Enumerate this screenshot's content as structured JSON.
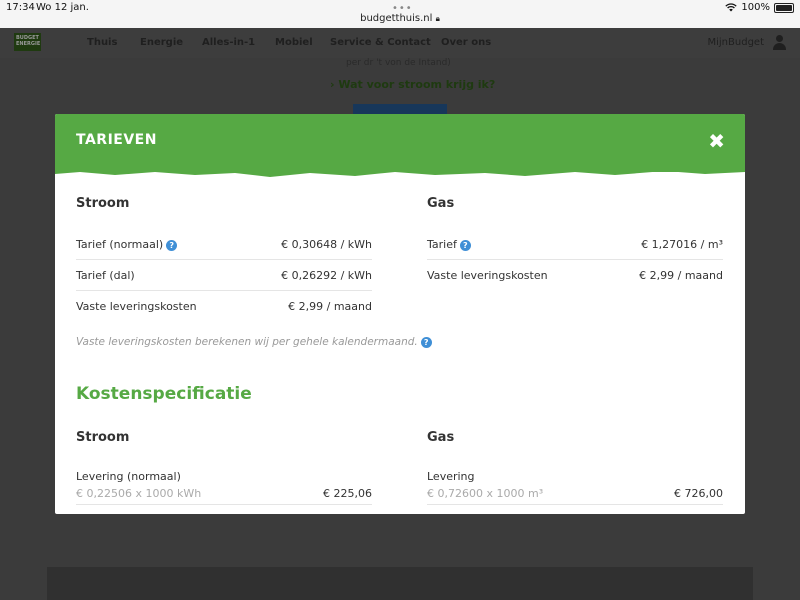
{
  "status_bar": {
    "time": "17:34",
    "date": "Wo 12 jan.",
    "url": "budgetthuis.nl",
    "battery": "100%"
  },
  "nav": {
    "logo": "BUDGET ENERGIE",
    "items": [
      "Thuis",
      "Energie",
      "Alles-in-1",
      "Mobiel",
      "Service & Contact",
      "Over ons"
    ],
    "account": "MijnBudget"
  },
  "background": {
    "partial_text": "per dr 't von de Intand)",
    "link": "Wat voor stroom krijg ik?"
  },
  "modal": {
    "title": "TARIEVEN",
    "close": "✖",
    "stroom": {
      "heading": "Stroom",
      "rows": [
        {
          "label": "Tarief (normaal)",
          "value": "€ 0,30648 / kWh"
        },
        {
          "label": "Tarief (dal)",
          "value": "€ 0,26292 / kWh"
        },
        {
          "label": "Vaste leveringskosten",
          "value": "€ 2,99 / maand"
        }
      ]
    },
    "gas": {
      "heading": "Gas",
      "rows": [
        {
          "label": "Tarief",
          "value": "€ 1,27016 / m³"
        },
        {
          "label": "Vaste leveringskosten",
          "value": "€ 2,99 / maand"
        }
      ]
    },
    "note": "Vaste leveringskosten berekenen wij per gehele kalendermaand.",
    "help_symbol": "?",
    "kosten": {
      "heading": "Kostenspecificatie",
      "stroom": {
        "heading": "Stroom",
        "label": "Levering (normaal)",
        "calc": "€ 0,22506 x 1000 kWh",
        "value": "€ 225,06"
      },
      "gas": {
        "heading": "Gas",
        "label": "Levering",
        "calc": "€ 0,72600 x 1000 m³",
        "value": "€ 726,00"
      }
    }
  },
  "colors": {
    "brand_green": "#56a944",
    "help_blue": "#3f8fd6"
  }
}
